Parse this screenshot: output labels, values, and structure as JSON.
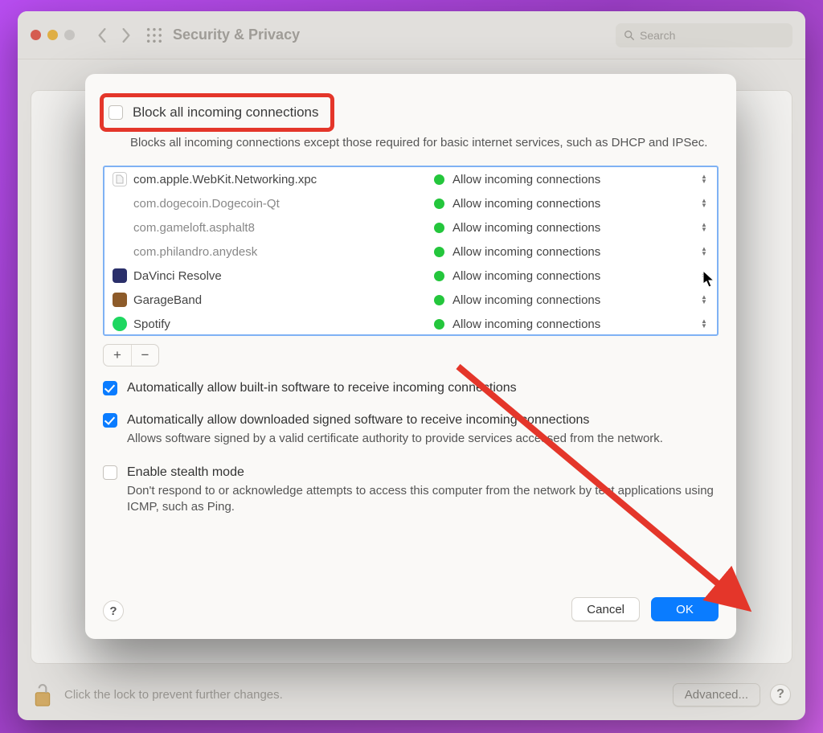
{
  "window": {
    "title": "Security & Privacy",
    "search_placeholder": "Search",
    "footer_text": "Click the lock to prevent further changes.",
    "advanced_button": "Advanced...",
    "help_glyph": "?"
  },
  "sheet": {
    "block_all": {
      "checked": false,
      "label": "Block all incoming connections",
      "sub": "Blocks all incoming connections except those required for basic internet services, such as DHCP and IPSec."
    },
    "apps": [
      {
        "name": "com.apple.WebKit.Networking.xpc",
        "status": "Allow incoming connections",
        "icon": "doc",
        "icon_bg": "#eeeeee",
        "icon_fg": "#888"
      },
      {
        "name": "com.dogecoin.Dogecoin-Qt",
        "status": "Allow incoming connections",
        "icon": "none"
      },
      {
        "name": "com.gameloft.asphalt8",
        "status": "Allow incoming connections",
        "icon": "none"
      },
      {
        "name": "com.philandro.anydesk",
        "status": "Allow incoming connections",
        "icon": "none"
      },
      {
        "name": "DaVinci Resolve",
        "status": "Allow incoming connections",
        "icon": "square",
        "icon_bg": "#2a2f6a"
      },
      {
        "name": "GarageBand",
        "status": "Allow incoming connections",
        "icon": "square",
        "icon_bg": "#8d5b2a"
      },
      {
        "name": "Spotify",
        "status": "Allow incoming connections",
        "icon": "circle",
        "icon_bg": "#1ed760"
      }
    ],
    "add_glyph": "+",
    "remove_glyph": "−",
    "auto_builtin": {
      "checked": true,
      "label": "Automatically allow built-in software to receive incoming connections"
    },
    "auto_signed": {
      "checked": true,
      "label": "Automatically allow downloaded signed software to receive incoming connections",
      "sub": "Allows software signed by a valid certificate authority to provide services accessed from the network."
    },
    "stealth": {
      "checked": false,
      "label": "Enable stealth mode",
      "sub": "Don't respond to or acknowledge attempts to access this computer from the network by test applications using ICMP, such as Ping."
    },
    "cancel": "Cancel",
    "ok": "OK",
    "help_glyph": "?"
  }
}
